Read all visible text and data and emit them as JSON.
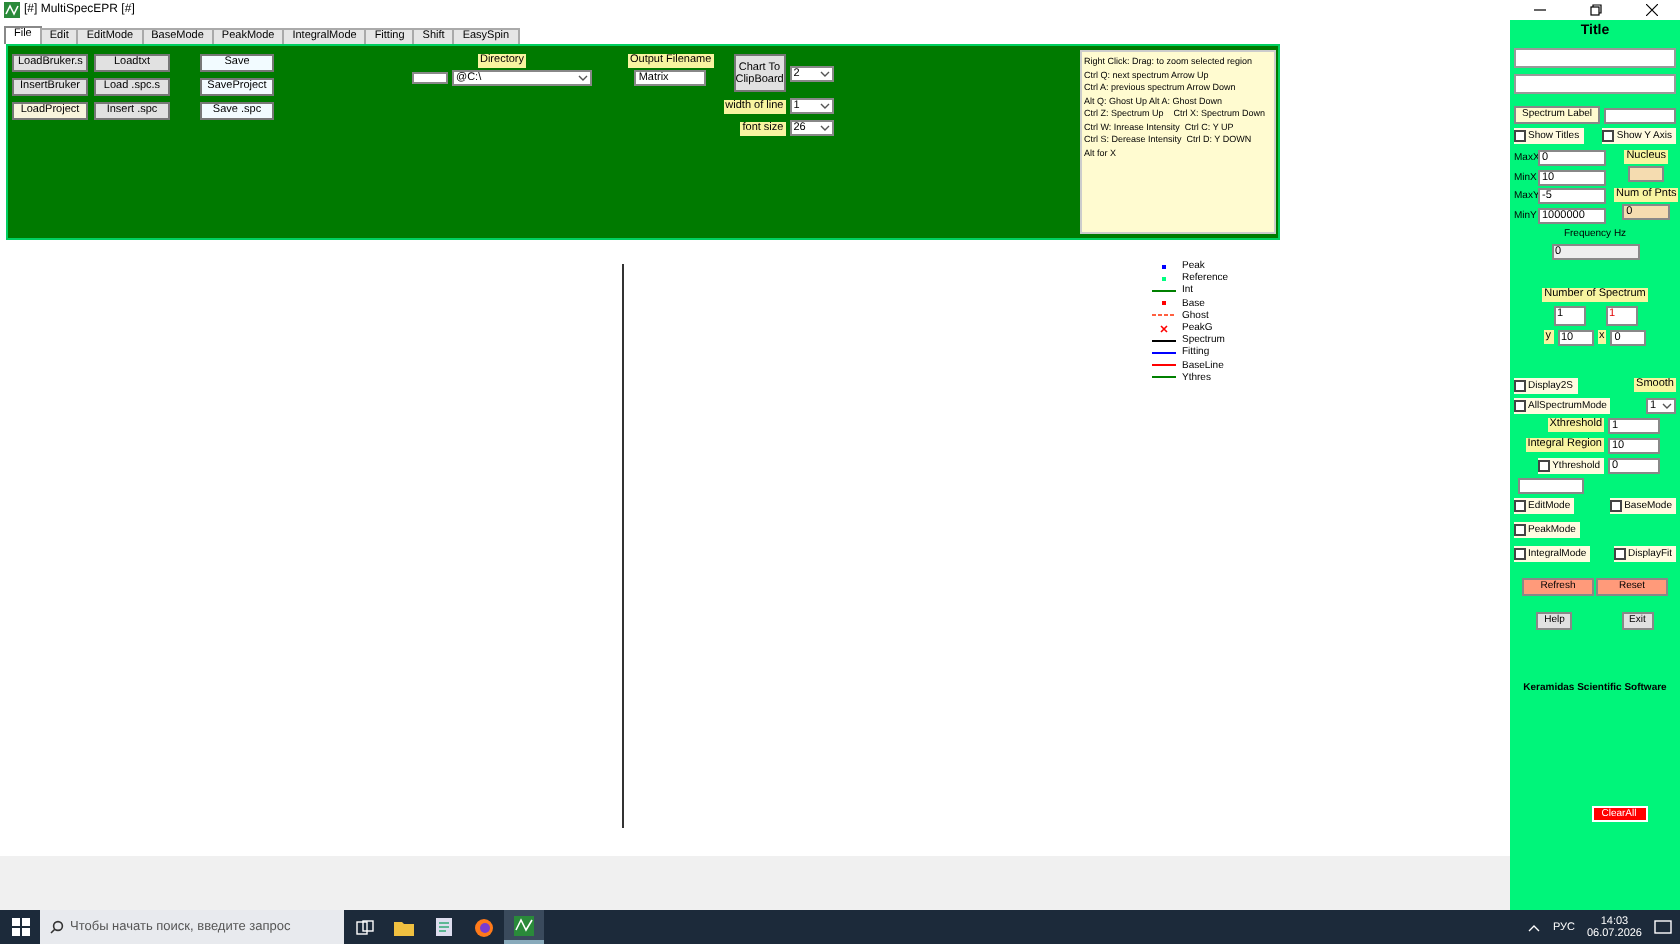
{
  "window": {
    "title": "[#] MultiSpecEPR [#]"
  },
  "menu_tabs": [
    {
      "label": "File",
      "selected": true
    },
    {
      "label": "Edit",
      "selected": false
    },
    {
      "label": "EditMode",
      "selected": false
    },
    {
      "label": "BaseMode",
      "selected": false
    },
    {
      "label": "PeakMode",
      "selected": false
    },
    {
      "label": "IntegralMode",
      "selected": false
    },
    {
      "label": "Fitting",
      "selected": false
    },
    {
      "label": "Shift",
      "selected": false
    },
    {
      "label": "EasySpin",
      "selected": false
    }
  ],
  "toolbar": {
    "button_columns": [
      [
        "LoadBruker.s",
        "InsertBruker",
        "LoadProject"
      ],
      [
        "Loadtxt",
        "Load .spc.s",
        "Insert .spc"
      ],
      [
        "Save",
        "SaveProject",
        "Save .spc"
      ]
    ],
    "directory": {
      "label": "Directory",
      "value": "@C:\\"
    },
    "output_filename": {
      "label": "Output Filename",
      "value": "Matrix"
    },
    "chart_button": "Chart To ClipBoard",
    "chart_value": "2",
    "width_of_line": {
      "label": "width of line",
      "value": "1"
    },
    "font_size": {
      "label": "font size",
      "value": "26"
    },
    "help_lines": [
      "Right Click: Drag: to zoom selected region",
      "Ctrl Q: next spectrum Arrow Up",
      "Ctrl A: previous spectrum Arrow Down",
      "Alt Q: Ghost Up Alt A: Ghost Down",
      "Ctrl Z: Spectrum Up    Ctrl X: Spectrum Down",
      "Ctrl W: Inrease Intensity  Ctrl C: Y UP",
      "Ctrl S: Derease Intensity  Ctrl D: Y DOWN",
      "Alt for X"
    ]
  },
  "legend": [
    {
      "label": "Peak",
      "kind": "dot",
      "color": "#0000ff"
    },
    {
      "label": "Reference",
      "kind": "dot",
      "color": "#00ff80"
    },
    {
      "label": "Int",
      "kind": "line",
      "color": "#008000"
    },
    {
      "label": "Base",
      "kind": "dot",
      "color": "#ff0000"
    },
    {
      "label": "Ghost",
      "kind": "dash",
      "color": "#ff6040"
    },
    {
      "label": "PeakG",
      "kind": "cross",
      "color": "#ff0000"
    },
    {
      "label": "Spectrum",
      "kind": "line",
      "color": "#000000"
    },
    {
      "label": "Fitting",
      "kind": "line",
      "color": "#0000ff"
    },
    {
      "label": "BaseLine",
      "kind": "line",
      "color": "#ff0000"
    },
    {
      "label": "Ythres",
      "kind": "line",
      "color": "#008000"
    }
  ],
  "side_panel": {
    "title": "Title",
    "spectrum_label": "Spectrum Label",
    "show_titles": {
      "label": "Show Titles",
      "checked": false
    },
    "show_y_axis": {
      "label": "Show Y Axis",
      "checked": false
    },
    "limits": [
      {
        "label": "MaxX",
        "value": "0"
      },
      {
        "label": "MinX",
        "value": "10"
      },
      {
        "label": "MaxY",
        "value": "-5"
      },
      {
        "label": "MinY",
        "value": "1000000"
      }
    ],
    "nucleus": "Nucleus",
    "num_of_pnts": {
      "label": "Num of Pnts",
      "value": "0"
    },
    "frequency": {
      "label": "Frequency Hz",
      "value": "0"
    },
    "number_of_spectrum": {
      "label": "Number of Spectrum",
      "current": "1",
      "total": "1"
    },
    "y": {
      "label": "y",
      "value": "10"
    },
    "x": {
      "label": "x",
      "value": "0"
    },
    "display2s": {
      "label": "Display2S",
      "checked": false
    },
    "smooth": {
      "label": "Smooth",
      "value": "1"
    },
    "all_spectrum_mode": {
      "label": "AllSpectrumMode",
      "checked": false
    },
    "xthreshold": {
      "label": "Xthreshold",
      "value": "1"
    },
    "integral_region": {
      "label": "Integral Region",
      "value": "10"
    },
    "ythreshold": {
      "label": "Ythreshold",
      "value": "0",
      "checked": false
    },
    "modes": [
      {
        "label": "EditMode",
        "checked": false
      },
      {
        "label": "BaseMode",
        "checked": false
      },
      {
        "label": "PeakMode",
        "checked": false
      },
      {
        "label": "IntegralMode",
        "checked": false
      },
      {
        "label": "DisplayFit",
        "checked": false
      }
    ],
    "refresh": "Refresh",
    "reset": "Reset",
    "help": "Help",
    "exit": "Exit",
    "credit": "Keramidas Scientific Software",
    "clear_all": "ClearAll"
  },
  "taskbar": {
    "search_placeholder": "Чтобы начать поиск, введите запрос",
    "language": "РУС",
    "time": "14:03",
    "date": "06.07.2026"
  }
}
